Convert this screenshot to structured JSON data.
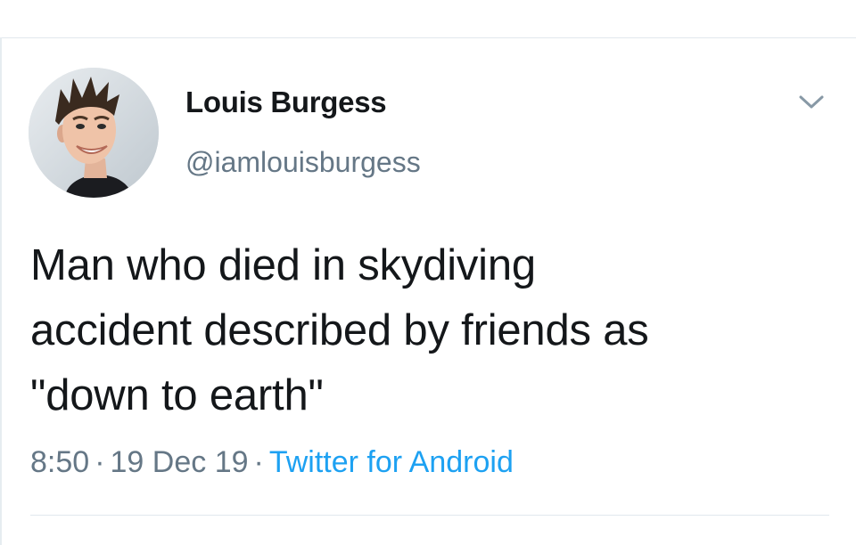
{
  "tweet": {
    "author": {
      "display_name": "Louis Burgess",
      "handle": "@iamlouisburgess",
      "avatar_icon": "profile-photo"
    },
    "text_lines": [
      "Man who died in skydiving",
      "accident described by friends as",
      "\"down to earth\""
    ],
    "meta": {
      "time": "8:50",
      "separator": "·",
      "date": "19 Dec 19",
      "source": "Twitter for Android"
    },
    "menu_icon": "chevron-down-icon"
  },
  "colors": {
    "text_primary": "#14171a",
    "text_secondary": "#657786",
    "link": "#1da1f2",
    "divider": "#e1e8ed"
  }
}
